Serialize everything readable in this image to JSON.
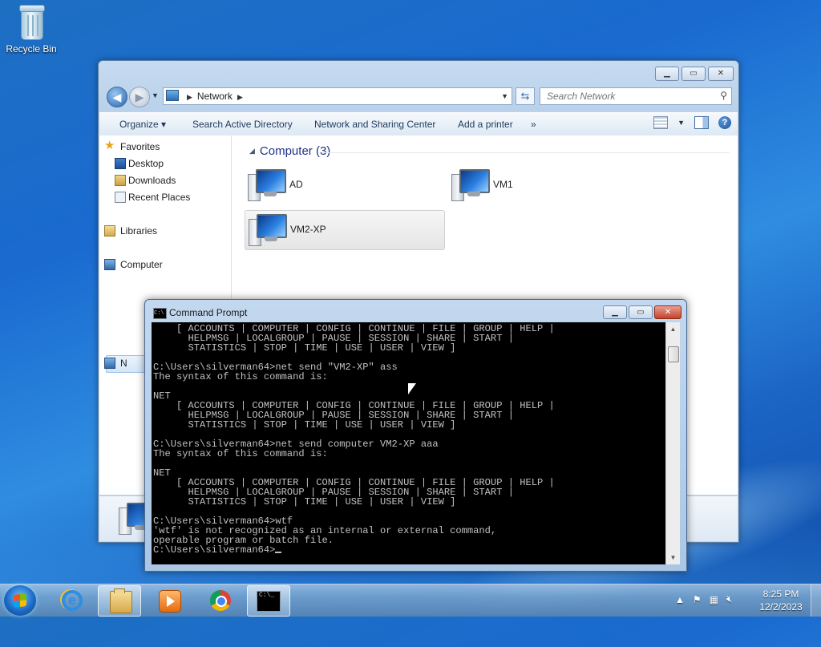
{
  "desktop": {
    "recycle_bin_label": "Recycle Bin"
  },
  "explorer": {
    "address": {
      "location": "Network"
    },
    "search": {
      "placeholder": "Search Network"
    },
    "commands": {
      "organize": "Organize",
      "search_ad": "Search Active Directory",
      "network_sharing": "Network and Sharing Center",
      "add_printer": "Add a printer",
      "more": "»"
    },
    "nav": {
      "favorites": "Favorites",
      "desktop": "Desktop",
      "downloads": "Downloads",
      "recent_places": "Recent Places",
      "libraries": "Libraries",
      "computer": "Computer",
      "network": "N"
    },
    "group_title": "Computer (3)",
    "computers": [
      {
        "name": "AD"
      },
      {
        "name": "VM1"
      },
      {
        "name": "VM2-XP",
        "selected": true
      }
    ]
  },
  "cmd": {
    "title": "Command Prompt",
    "console_text": "    [ ACCOUNTS | COMPUTER | CONFIG | CONTINUE | FILE | GROUP | HELP |\n      HELPMSG | LOCALGROUP | PAUSE | SESSION | SHARE | START |\n      STATISTICS | STOP | TIME | USE | USER | VIEW ]\n\nC:\\Users\\silverman64>net send \"VM2-XP\" ass\nThe syntax of this command is:\n\nNET\n    [ ACCOUNTS | COMPUTER | CONFIG | CONTINUE | FILE | GROUP | HELP |\n      HELPMSG | LOCALGROUP | PAUSE | SESSION | SHARE | START |\n      STATISTICS | STOP | TIME | USE | USER | VIEW ]\n\nC:\\Users\\silverman64>net send computer VM2-XP aaa\nThe syntax of this command is:\n\nNET\n    [ ACCOUNTS | COMPUTER | CONFIG | CONTINUE | FILE | GROUP | HELP |\n      HELPMSG | LOCALGROUP | PAUSE | SESSION | SHARE | START |\n      STATISTICS | STOP | TIME | USE | USER | VIEW ]\n\nC:\\Users\\silverman64>wtf\n'wtf' is not recognized as an internal or external command,\noperable program or batch file.\n",
    "prompt": "C:\\Users\\silverman64>"
  },
  "taskbar": {
    "items": [
      {
        "icon": "internet-explorer-icon"
      },
      {
        "icon": "windows-explorer-icon",
        "active": true
      },
      {
        "icon": "media-player-icon"
      },
      {
        "icon": "chrome-icon"
      },
      {
        "icon": "command-prompt-icon",
        "active": true
      }
    ],
    "time": "8:25 PM",
    "date": "12/2/2023"
  },
  "colors": {
    "console_bg": "#000000",
    "console_fg": "#c0c0c0",
    "group_title": "#1e3287"
  }
}
